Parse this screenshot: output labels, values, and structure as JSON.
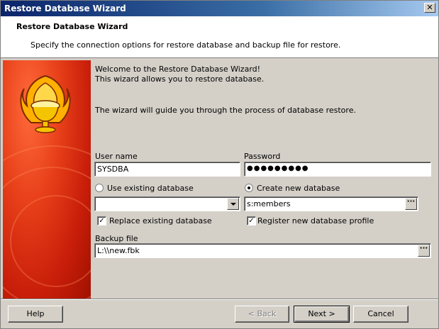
{
  "window": {
    "title": "Restore Database Wizard",
    "close_glyph": "✕"
  },
  "header": {
    "title": "Restore Database Wizard",
    "subtitle": "Specify the connection options for restore database and backup file for restore."
  },
  "intro": {
    "line1": "Welcome to the Restore Database Wizard!",
    "line2": "This wizard allows you to restore database.",
    "line3": "The wizard will guide you through the process of database restore."
  },
  "form": {
    "username_label": "User name",
    "username_value": "SYSDBA",
    "password_label": "Password",
    "password_value": "●●●●●●●●●",
    "use_existing_label": "Use existing database",
    "use_existing_selected": false,
    "create_new_label": "Create new database",
    "create_new_selected": true,
    "existing_db_value": "",
    "new_db_value": "s:members",
    "replace_existing_label": "Replace existing database",
    "replace_existing_checked": true,
    "register_profile_label": "Register new database profile",
    "register_profile_checked": true,
    "backup_file_label": "Backup file",
    "backup_file_value": "L:\\\\new.fbk",
    "ellipsis": "···",
    "check_glyph": "✓"
  },
  "buttons": {
    "help": "Help",
    "back": "< Back",
    "next": "Next >",
    "cancel": "Cancel"
  }
}
